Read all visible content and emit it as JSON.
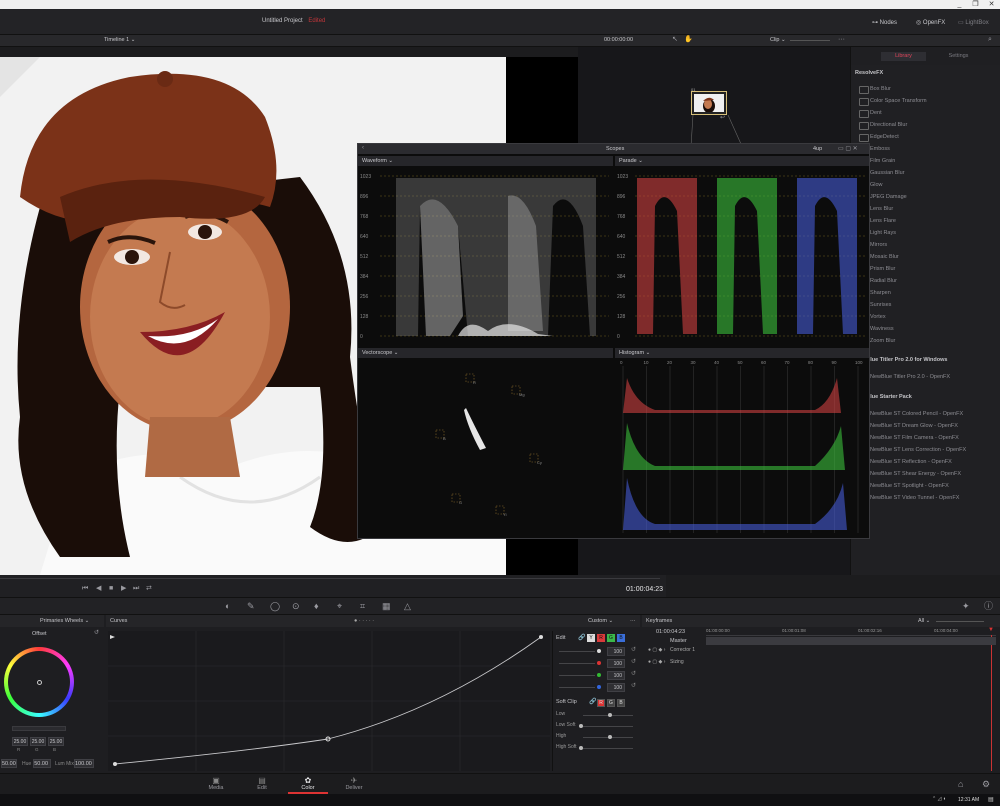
{
  "window": {
    "minimize": "_",
    "maximize": "❐",
    "close": "✕"
  },
  "app": {
    "project_title": "Untitled Project",
    "project_status": "Edited"
  },
  "header_tabs": {
    "nodes": "Nodes",
    "openfx": "OpenFX",
    "lightbox": "LightBox"
  },
  "viewer": {
    "timeline_name": "Timeline 1",
    "timecode_top": "00:00:00:00",
    "clip_label": "Clip",
    "timecode": "01:00:04:23"
  },
  "openfx": {
    "tabs": [
      "Library",
      "Settings"
    ],
    "section_resolve": "ResolveFX",
    "resolve_items": [
      "Box Blur",
      "Color Space Transform",
      "Dent",
      "Directional Blur",
      "EdgeDetect",
      "Emboss",
      "Film Grain",
      "Gaussian Blur",
      "Glow",
      "JPEG Damage",
      "Lens Blur",
      "Lens Flare",
      "Light Rays",
      "Mirrors",
      "Mosaic Blur",
      "Prism Blur",
      "Radial Blur",
      "Sharpen",
      "Sunrises",
      "Vortex",
      "Waviness",
      "Zoom Blur"
    ],
    "section_titler": "NewBlue Titler Pro 2.0 for Windows",
    "titler_items": [
      "NewBlue Titler Pro 2.0 - OpenFX"
    ],
    "section_starter": "NewBlue Starter Pack",
    "starter_items": [
      "NewBlue ST Colored Pencil - OpenFX",
      "NewBlue ST Dream Glow - OpenFX",
      "NewBlue ST Film Camera - OpenFX",
      "NewBlue ST Lens Correction - OpenFX",
      "NewBlue ST Reflection - OpenFX",
      "NewBlue ST Shear Energy - OpenFX",
      "NewBlue ST Spotlight - OpenFX",
      "NewBlue ST Video Tunnel - OpenFX"
    ]
  },
  "scopes": {
    "title": "Scopes",
    "layout": "4up",
    "waveform": "Waveform",
    "parade": "Parade",
    "vectorscope": "Vectorscope",
    "histogram": "Histogram",
    "ticks": [
      "1023",
      "896",
      "768",
      "640",
      "512",
      "384",
      "256",
      "128",
      "0"
    ],
    "hist_ticks": [
      "0",
      "10",
      "20",
      "30",
      "40",
      "50",
      "60",
      "70",
      "80",
      "90",
      "100"
    ],
    "vector_targets": [
      "R",
      "Mg",
      "B",
      "Cy",
      "G",
      "Yl"
    ],
    "colors": {
      "red": "#e04545",
      "green": "#3fcf3f",
      "blue": "#4a63e8"
    }
  },
  "color_tools": {
    "primaries_title": "Primaries Wheels",
    "offset_label": "Offset",
    "rgb_values": [
      "25.00",
      "25.00",
      "25.00"
    ],
    "rgb_labels": [
      "R",
      "G",
      "B"
    ],
    "bottom_fields": {
      "contrast_value": "50.00",
      "hue_label": "Hue",
      "hue_value": "50.00",
      "lummix_label": "Lum Mix",
      "lummix_value": "100.00"
    },
    "curves_title": "Curves",
    "curves_mode": "Custom",
    "edit_label": "Edit",
    "edit_channels": [
      "Y",
      "R",
      "G",
      "B"
    ],
    "intensity": [
      "100",
      "100",
      "100",
      "100"
    ],
    "softclip_label": "Soft Clip",
    "softclip_btns": [
      "R",
      "G",
      "B"
    ],
    "softclip_rows": [
      "Low",
      "Low Soft",
      "High",
      "High Soft"
    ]
  },
  "keyframes": {
    "title": "Keyframes",
    "filter": "All",
    "timecode": "01:00:04:23",
    "ruler": [
      "01:00:00:00",
      "01:00:01:08",
      "01:00:02:16",
      "01:00:04:00"
    ],
    "master": "Master",
    "tracks": [
      "Corrector 1",
      "Sizing"
    ]
  },
  "pages": [
    "Media",
    "Edit",
    "Color",
    "Deliver"
  ],
  "active_page": "Color",
  "taskbar": {
    "clock": "12:31 AM"
  }
}
